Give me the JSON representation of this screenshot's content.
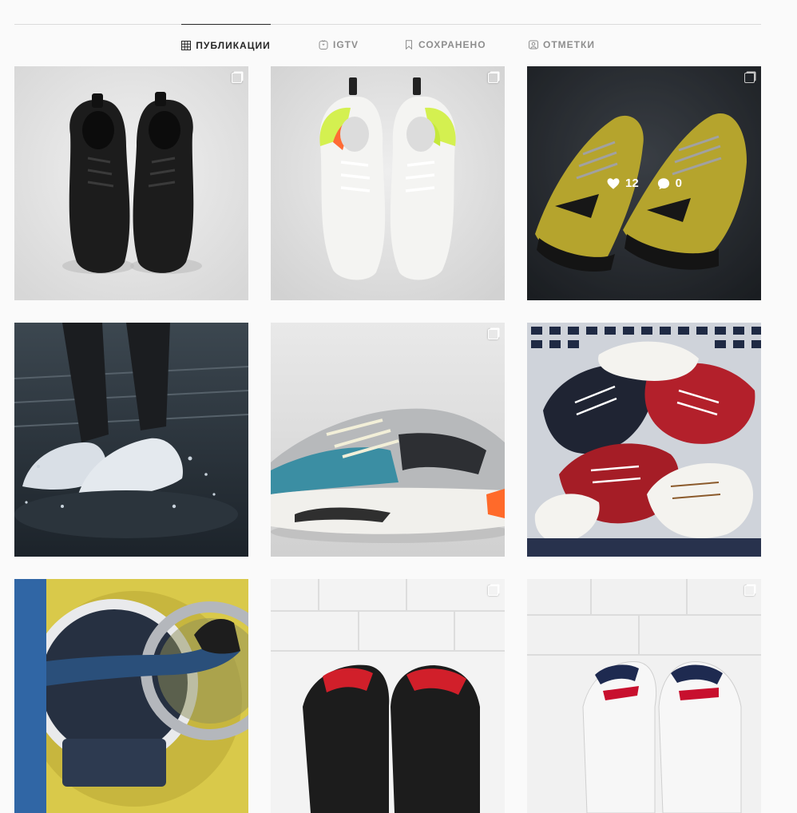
{
  "tabs": [
    {
      "label": "ПУБЛИКАЦИИ",
      "icon": "grid-icon",
      "active": true
    },
    {
      "label": "IGTV",
      "icon": "igtv-icon",
      "active": false
    },
    {
      "label": "СОХРАНЕНО",
      "icon": "bookmark-icon",
      "active": false
    },
    {
      "label": "ОТМЕТКИ",
      "icon": "tagged-icon",
      "active": false
    }
  ],
  "posts": [
    {
      "subject": "black adidas sneakers",
      "multi": true
    },
    {
      "subject": "white nike m2k tekno sneakers",
      "multi": true
    },
    {
      "subject": "yellow balenciaga track sneakers",
      "multi": true,
      "hover": {
        "likes": "12",
        "comments": "0"
      }
    },
    {
      "subject": "white sneakers splashing water",
      "multi": false
    },
    {
      "subject": "yeezy 700 wave runner",
      "multi": true
    },
    {
      "subject": "converse in laundry basket",
      "multi": false
    },
    {
      "subject": "legs in washing machine",
      "multi": false
    },
    {
      "subject": "red black sneakers",
      "multi": true
    },
    {
      "subject": "white fila sneakers",
      "multi": true
    }
  ],
  "colors": {
    "active_tab": "#262626",
    "inactive_tab": "#8e8e8e",
    "divider": "#dbdbdb",
    "background": "#fafafa"
  }
}
